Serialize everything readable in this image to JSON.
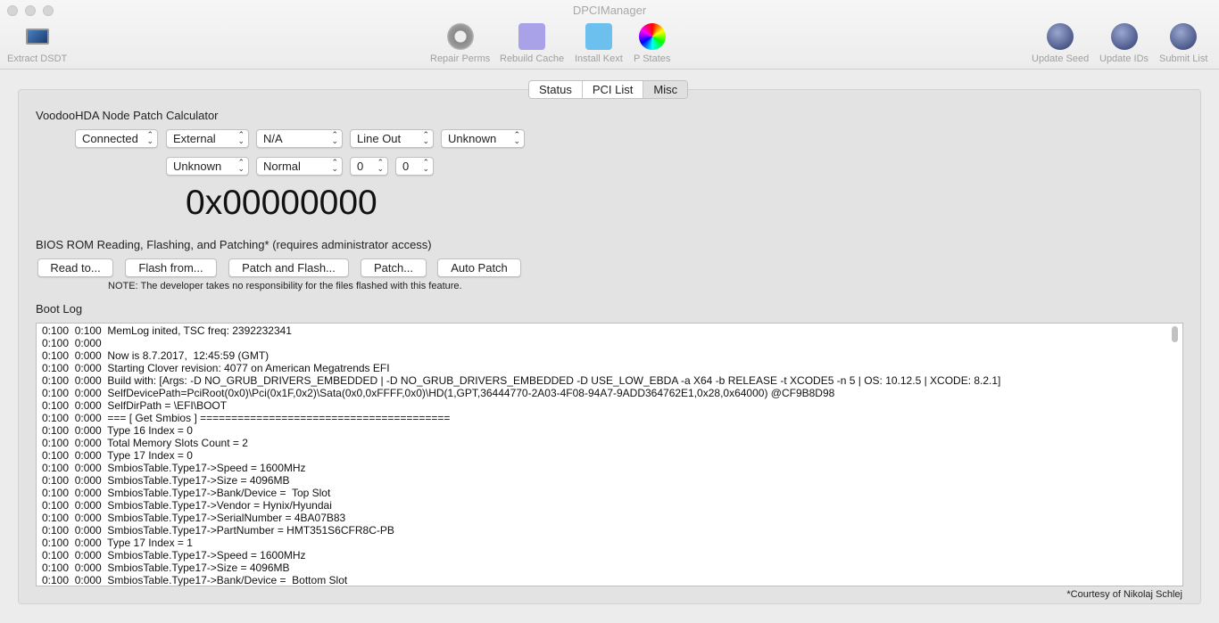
{
  "window": {
    "title": "DPCIManager"
  },
  "toolbar": {
    "extract": "Extract DSDT",
    "repair": "Repair Perms",
    "rebuild": "Rebuild Cache",
    "install": "Install Kext",
    "pstates": "P States",
    "seed": "Update Seed",
    "ids": "Update IDs",
    "submit": "Submit List"
  },
  "tabs": [
    "Status",
    "PCI List",
    "Misc"
  ],
  "calc": {
    "title": "VoodooHDA Node Patch Calculator",
    "row1": [
      "Connected",
      "External",
      "N/A",
      "Line Out",
      "Unknown"
    ],
    "row2": [
      "Unknown",
      "Normal",
      "0",
      "0"
    ],
    "result": "0x00000000"
  },
  "bios": {
    "title": "BIOS ROM Reading, Flashing, and Patching* (requires administrator access)",
    "buttons": [
      "Read to...",
      "Flash from...",
      "Patch and Flash...",
      "Patch...",
      "Auto Patch"
    ],
    "note": "NOTE: The developer takes no responsibility for the files flashed with this feature."
  },
  "bootlog": {
    "title": "Boot Log",
    "lines": [
      "0:100  0:100  MemLog inited, TSC freq: 2392232341",
      "0:100  0:000",
      "0:100  0:000  Now is 8.7.2017,  12:45:59 (GMT)",
      "0:100  0:000  Starting Clover revision: 4077 on American Megatrends EFI",
      "0:100  0:000  Build with: [Args: -D NO_GRUB_DRIVERS_EMBEDDED | -D NO_GRUB_DRIVERS_EMBEDDED -D USE_LOW_EBDA -a X64 -b RELEASE -t XCODE5 -n 5 | OS: 10.12.5 | XCODE: 8.2.1]",
      "0:100  0:000  SelfDevicePath=PciRoot(0x0)\\Pci(0x1F,0x2)\\Sata(0x0,0xFFFF,0x0)\\HD(1,GPT,36444770-2A03-4F08-94A7-9ADD364762E1,0x28,0x64000) @CF9B8D98",
      "0:100  0:000  SelfDirPath = \\EFI\\BOOT",
      "0:100  0:000  === [ Get Smbios ] ========================================",
      "0:100  0:000  Type 16 Index = 0",
      "0:100  0:000  Total Memory Slots Count = 2",
      "0:100  0:000  Type 17 Index = 0",
      "0:100  0:000  SmbiosTable.Type17->Speed = 1600MHz",
      "0:100  0:000  SmbiosTable.Type17->Size = 4096MB",
      "0:100  0:000  SmbiosTable.Type17->Bank/Device =  Top Slot",
      "0:100  0:000  SmbiosTable.Type17->Vendor = Hynix/Hyundai",
      "0:100  0:000  SmbiosTable.Type17->SerialNumber = 4BA07B83",
      "0:100  0:000  SmbiosTable.Type17->PartNumber = HMT351S6CFR8C-PB",
      "0:100  0:000  Type 17 Index = 1",
      "0:100  0:000  SmbiosTable.Type17->Speed = 1600MHz",
      "0:100  0:000  SmbiosTable.Type17->Size = 4096MB",
      "0:100  0:000  SmbiosTable.Type17->Bank/Device =  Bottom Slot"
    ]
  },
  "footer": "*Courtesy of Nikolaj Schlej"
}
